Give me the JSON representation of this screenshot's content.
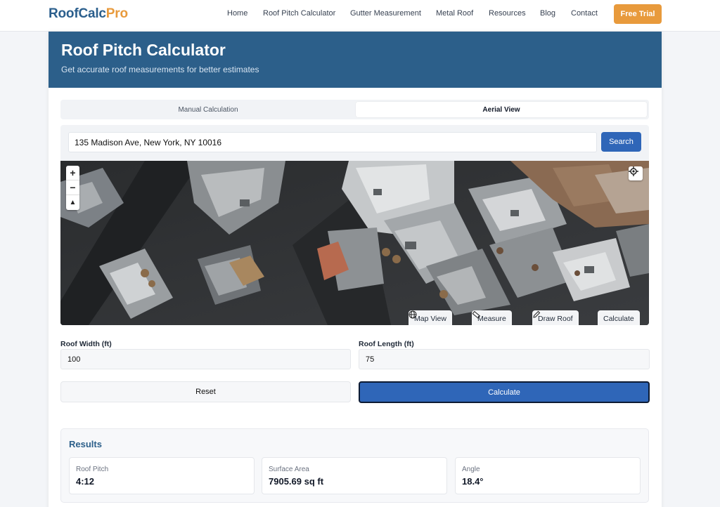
{
  "nav": {
    "brand_first": "RoofCalc",
    "brand_second": "Pro",
    "links": [
      "Home",
      "Roof Pitch Calculator",
      "Gutter Measurement",
      "Metal Roof",
      "Resources",
      "Blog",
      "Contact"
    ],
    "cta": "Free Trial"
  },
  "hero": {
    "title": "Roof Pitch Calculator",
    "subtitle": "Get accurate roof measurements for better estimates"
  },
  "tabs": [
    "Manual Calculation",
    "Aerial View"
  ],
  "active_tab": "Aerial View",
  "search": {
    "address": "135 Madison Ave, New York, NY 10016",
    "button": "Search"
  },
  "map": {
    "zoom_in": "+",
    "zoom_out": "−",
    "compass": "▲",
    "tools": [
      "Map View",
      "Measure",
      "Draw Roof",
      "Calculate"
    ]
  },
  "form": {
    "width_label": "Roof Width (ft)",
    "width_value": "100",
    "length_label": "Roof Length (ft)",
    "length_value": "75",
    "reset": "Reset",
    "calculate": "Calculate"
  },
  "results": {
    "heading": "Results",
    "items": [
      {
        "label": "Roof Pitch",
        "value": "4:12"
      },
      {
        "label": "Surface Area",
        "value": "7905.69 sq ft"
      },
      {
        "label": "Angle",
        "value": "18.4°"
      }
    ]
  },
  "colors": {
    "brand_blue": "#2c5f8a",
    "brand_orange": "#e89a3c",
    "button_blue": "#2f66b8"
  }
}
